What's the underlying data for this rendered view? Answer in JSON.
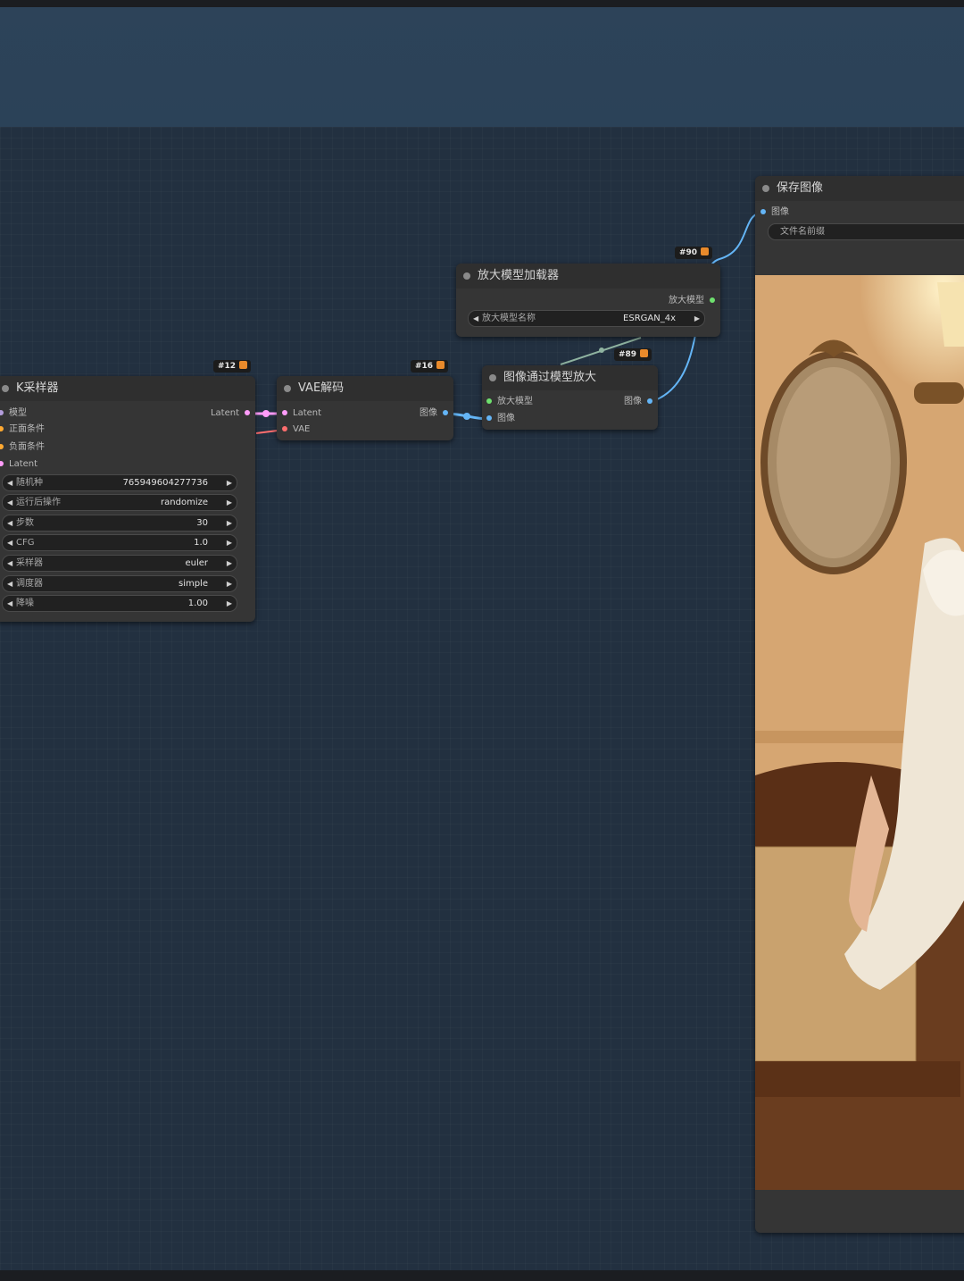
{
  "nodes": {
    "ksampler": {
      "title": "K采样器",
      "inputs": [
        "模型",
        "正面条件",
        "负面条件",
        "Latent"
      ],
      "output": "Latent",
      "badge": "#12",
      "widgets": [
        {
          "label": "随机种",
          "value": "765949604277736"
        },
        {
          "label": "运行后操作",
          "value": "randomize"
        },
        {
          "label": "步数",
          "value": "30"
        },
        {
          "label": "CFG",
          "value": "1.0"
        },
        {
          "label": "采样器",
          "value": "euler"
        },
        {
          "label": "调度器",
          "value": "simple"
        },
        {
          "label": "降噪",
          "value": "1.00"
        }
      ]
    },
    "vae_decode": {
      "title": "VAE解码",
      "inputs": [
        "Latent",
        "VAE"
      ],
      "output": "图像",
      "badge": "#16"
    },
    "upscale_loader": {
      "title": "放大模型加载器",
      "output": "放大模型",
      "badge": "#90",
      "widget": {
        "label": "放大模型名称",
        "value": "ESRGAN_4x"
      }
    },
    "upscale_with_model": {
      "title": "图像通过模型放大",
      "inputs": [
        "放大模型",
        "图像"
      ],
      "output": "图像",
      "badge": "#89"
    },
    "save_image": {
      "title": "保存图像",
      "input": "图像",
      "widget_label": "文件名前缀"
    }
  },
  "colors": {
    "latent": "#ff9cf9",
    "model": "#b39ddb",
    "conditioning": "#ffa931",
    "vae": "#ff6e6e",
    "image": "#64b5f6",
    "upscale_model": "#6ee06e"
  },
  "icons": {
    "arrow_left": "◀",
    "arrow_right": "▶"
  }
}
